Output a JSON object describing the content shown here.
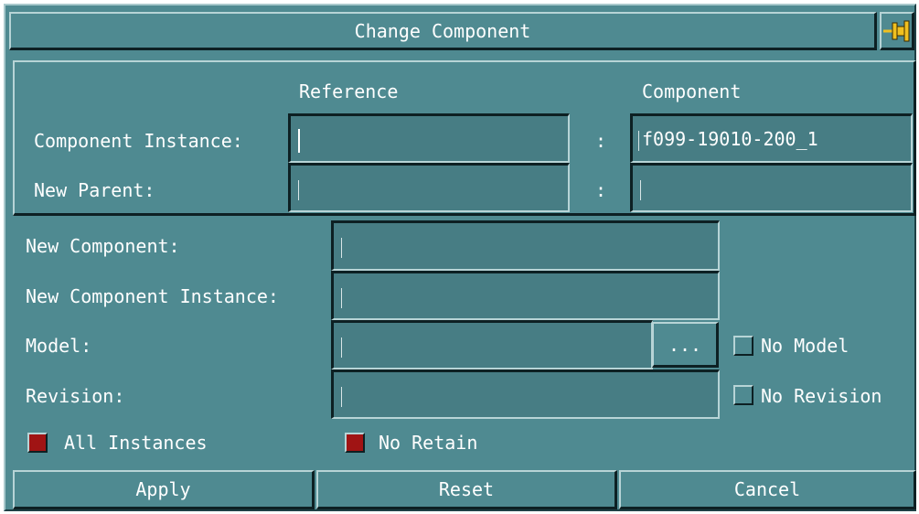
{
  "dialog": {
    "title": "Change Component",
    "pin_icon": "pushpin-icon"
  },
  "group": {
    "reference_header": "Reference",
    "component_header": "Component",
    "rows": [
      {
        "label": "Component Instance:",
        "separator": ":",
        "reference_value": "",
        "component_value": "f099-19010-200_1"
      },
      {
        "label": "New Parent:",
        "separator": ":",
        "reference_value": "",
        "component_value": ""
      }
    ]
  },
  "form": {
    "new_component_label": "New Component:",
    "new_component_value": "",
    "new_component_instance_label": "New Component Instance:",
    "new_component_instance_value": "",
    "model_label": "Model:",
    "model_value": "",
    "browse_label": "...",
    "no_model_label": "No Model",
    "no_model_checked": false,
    "revision_label": "Revision:",
    "revision_value": "",
    "no_revision_label": "No Revision",
    "no_revision_checked": false,
    "all_instances_label": "All Instances",
    "all_instances_checked": true,
    "no_retain_label": "No Retain",
    "no_retain_checked": true
  },
  "actions": {
    "apply": "Apply",
    "reset": "Reset",
    "cancel": "Cancel"
  },
  "colors": {
    "background": "#4f8a91",
    "field": "#477d84",
    "checked": "#a01414",
    "text": "#ffffff"
  }
}
